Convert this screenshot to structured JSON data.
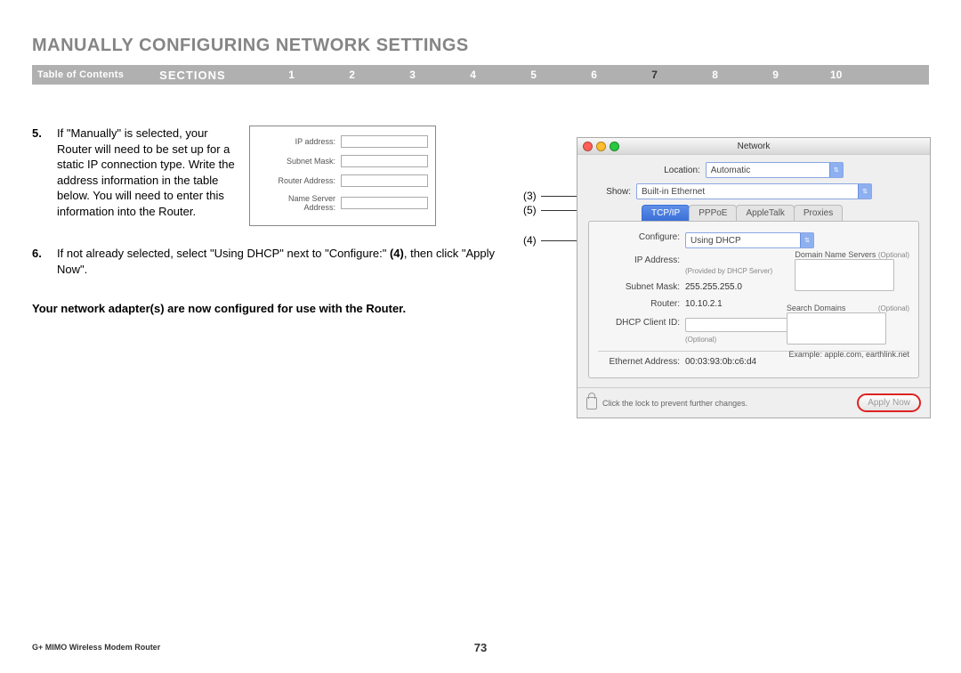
{
  "header": {
    "title": "MANUALLY CONFIGURING NETWORK SETTINGS"
  },
  "nav": {
    "toc": "Table of Contents",
    "sections_label": "SECTIONS",
    "items": [
      "1",
      "2",
      "3",
      "4",
      "5",
      "6",
      "7",
      "8",
      "9",
      "10"
    ],
    "active": "7"
  },
  "steps": {
    "step5": {
      "num": "5.",
      "text": "If \"Manually\" is selected, your Router will need to be set up for a static IP connection type. Write the address information in the table below. You will need to enter this information into the Router."
    },
    "step6": {
      "num": "6.",
      "text_a": "If not already selected, select \"Using DHCP\" next to \"Configure:\" ",
      "bold": "(4)",
      "text_b": ", then click \"Apply Now\"."
    }
  },
  "ip_table": {
    "rows": [
      "IP address:",
      "Subnet Mask:",
      "Router Address:",
      "Name Server Address:"
    ]
  },
  "callouts": [
    "(3)",
    "(5)",
    "(4)"
  ],
  "callout_line_widths": [
    80,
    85,
    150
  ],
  "completion": "Your network adapter(s) are now configured for use with the Router.",
  "mac": {
    "title": "Network",
    "location_label": "Location:",
    "location_value": "Automatic",
    "show_label": "Show:",
    "show_value": "Built-in Ethernet",
    "tabs": [
      "TCP/IP",
      "PPPoE",
      "AppleTalk",
      "Proxies"
    ],
    "configure_label": "Configure:",
    "configure_value": "Using DHCP",
    "dns_label": "Domain Name Servers",
    "optional": "(Optional)",
    "ip_label": "IP Address:",
    "ip_note": "(Provided by DHCP Server)",
    "subnet_label": "Subnet Mask:",
    "subnet_value": "255.255.255.0",
    "router_label": "Router:",
    "router_value": "10.10.2.1",
    "search_label": "Search Domains",
    "dhcp_label": "DHCP Client ID:",
    "example": "Example: apple.com, earthlink.net",
    "eth_label": "Ethernet Address:",
    "eth_value": "00:03:93:0b:c6:d4",
    "lock_text": "Click the lock to prevent further changes.",
    "apply": "Apply Now"
  },
  "footer": {
    "product": "G+ MIMO Wireless Modem Router",
    "page": "73"
  }
}
